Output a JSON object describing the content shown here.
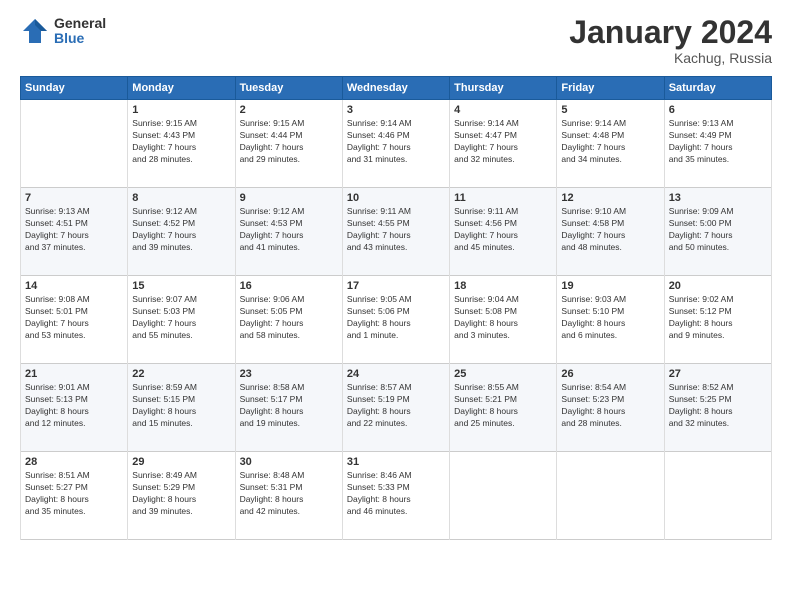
{
  "logo": {
    "general": "General",
    "blue": "Blue"
  },
  "title": "January 2024",
  "location": "Kachug, Russia",
  "days_header": [
    "Sunday",
    "Monday",
    "Tuesday",
    "Wednesday",
    "Thursday",
    "Friday",
    "Saturday"
  ],
  "weeks": [
    [
      {
        "day": "",
        "content": ""
      },
      {
        "day": "1",
        "content": "Sunrise: 9:15 AM\nSunset: 4:43 PM\nDaylight: 7 hours\nand 28 minutes."
      },
      {
        "day": "2",
        "content": "Sunrise: 9:15 AM\nSunset: 4:44 PM\nDaylight: 7 hours\nand 29 minutes."
      },
      {
        "day": "3",
        "content": "Sunrise: 9:14 AM\nSunset: 4:46 PM\nDaylight: 7 hours\nand 31 minutes."
      },
      {
        "day": "4",
        "content": "Sunrise: 9:14 AM\nSunset: 4:47 PM\nDaylight: 7 hours\nand 32 minutes."
      },
      {
        "day": "5",
        "content": "Sunrise: 9:14 AM\nSunset: 4:48 PM\nDaylight: 7 hours\nand 34 minutes."
      },
      {
        "day": "6",
        "content": "Sunrise: 9:13 AM\nSunset: 4:49 PM\nDaylight: 7 hours\nand 35 minutes."
      }
    ],
    [
      {
        "day": "7",
        "content": "Sunrise: 9:13 AM\nSunset: 4:51 PM\nDaylight: 7 hours\nand 37 minutes."
      },
      {
        "day": "8",
        "content": "Sunrise: 9:12 AM\nSunset: 4:52 PM\nDaylight: 7 hours\nand 39 minutes."
      },
      {
        "day": "9",
        "content": "Sunrise: 9:12 AM\nSunset: 4:53 PM\nDaylight: 7 hours\nand 41 minutes."
      },
      {
        "day": "10",
        "content": "Sunrise: 9:11 AM\nSunset: 4:55 PM\nDaylight: 7 hours\nand 43 minutes."
      },
      {
        "day": "11",
        "content": "Sunrise: 9:11 AM\nSunset: 4:56 PM\nDaylight: 7 hours\nand 45 minutes."
      },
      {
        "day": "12",
        "content": "Sunrise: 9:10 AM\nSunset: 4:58 PM\nDaylight: 7 hours\nand 48 minutes."
      },
      {
        "day": "13",
        "content": "Sunrise: 9:09 AM\nSunset: 5:00 PM\nDaylight: 7 hours\nand 50 minutes."
      }
    ],
    [
      {
        "day": "14",
        "content": "Sunrise: 9:08 AM\nSunset: 5:01 PM\nDaylight: 7 hours\nand 53 minutes."
      },
      {
        "day": "15",
        "content": "Sunrise: 9:07 AM\nSunset: 5:03 PM\nDaylight: 7 hours\nand 55 minutes."
      },
      {
        "day": "16",
        "content": "Sunrise: 9:06 AM\nSunset: 5:05 PM\nDaylight: 7 hours\nand 58 minutes."
      },
      {
        "day": "17",
        "content": "Sunrise: 9:05 AM\nSunset: 5:06 PM\nDaylight: 8 hours\nand 1 minute."
      },
      {
        "day": "18",
        "content": "Sunrise: 9:04 AM\nSunset: 5:08 PM\nDaylight: 8 hours\nand 3 minutes."
      },
      {
        "day": "19",
        "content": "Sunrise: 9:03 AM\nSunset: 5:10 PM\nDaylight: 8 hours\nand 6 minutes."
      },
      {
        "day": "20",
        "content": "Sunrise: 9:02 AM\nSunset: 5:12 PM\nDaylight: 8 hours\nand 9 minutes."
      }
    ],
    [
      {
        "day": "21",
        "content": "Sunrise: 9:01 AM\nSunset: 5:13 PM\nDaylight: 8 hours\nand 12 minutes."
      },
      {
        "day": "22",
        "content": "Sunrise: 8:59 AM\nSunset: 5:15 PM\nDaylight: 8 hours\nand 15 minutes."
      },
      {
        "day": "23",
        "content": "Sunrise: 8:58 AM\nSunset: 5:17 PM\nDaylight: 8 hours\nand 19 minutes."
      },
      {
        "day": "24",
        "content": "Sunrise: 8:57 AM\nSunset: 5:19 PM\nDaylight: 8 hours\nand 22 minutes."
      },
      {
        "day": "25",
        "content": "Sunrise: 8:55 AM\nSunset: 5:21 PM\nDaylight: 8 hours\nand 25 minutes."
      },
      {
        "day": "26",
        "content": "Sunrise: 8:54 AM\nSunset: 5:23 PM\nDaylight: 8 hours\nand 28 minutes."
      },
      {
        "day": "27",
        "content": "Sunrise: 8:52 AM\nSunset: 5:25 PM\nDaylight: 8 hours\nand 32 minutes."
      }
    ],
    [
      {
        "day": "28",
        "content": "Sunrise: 8:51 AM\nSunset: 5:27 PM\nDaylight: 8 hours\nand 35 minutes."
      },
      {
        "day": "29",
        "content": "Sunrise: 8:49 AM\nSunset: 5:29 PM\nDaylight: 8 hours\nand 39 minutes."
      },
      {
        "day": "30",
        "content": "Sunrise: 8:48 AM\nSunset: 5:31 PM\nDaylight: 8 hours\nand 42 minutes."
      },
      {
        "day": "31",
        "content": "Sunrise: 8:46 AM\nSunset: 5:33 PM\nDaylight: 8 hours\nand 46 minutes."
      },
      {
        "day": "",
        "content": ""
      },
      {
        "day": "",
        "content": ""
      },
      {
        "day": "",
        "content": ""
      }
    ]
  ]
}
